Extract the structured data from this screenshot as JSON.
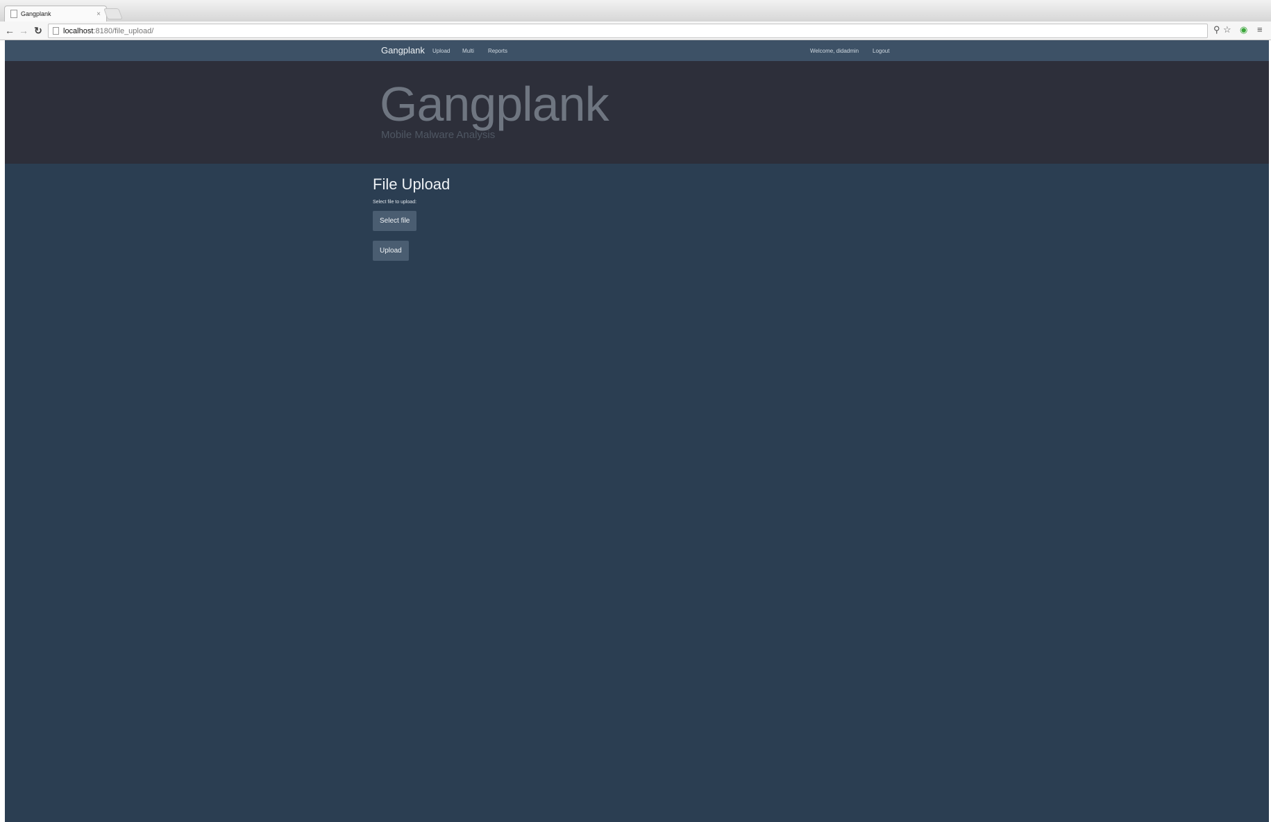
{
  "browser": {
    "tab_title": "Gangplank",
    "tab_close": "×",
    "url_host": "localhost",
    "url_rest": ":8180/file_upload/",
    "icons": [
      "back-icon",
      "forward-icon",
      "reload-icon",
      "page-icon",
      "zoom-icon",
      "star-icon",
      "extension-icon",
      "menu-icon"
    ]
  },
  "navbar": {
    "brand": "Gangplank",
    "links": [
      "Upload",
      "Multi",
      "Reports"
    ],
    "welcome": "Welcome, didadmin",
    "logout": "Logout"
  },
  "hero": {
    "title": "Gangplank",
    "subtitle": "Mobile Malware Analysis"
  },
  "main": {
    "heading": "File Upload",
    "label": "Select file to upload:",
    "select_button": "Select file",
    "upload_button": "Upload"
  },
  "colors": {
    "navbar": "#3d5166",
    "hero": "#2d2f3a",
    "page": "#2b3e52",
    "button": "#4a5d71"
  }
}
